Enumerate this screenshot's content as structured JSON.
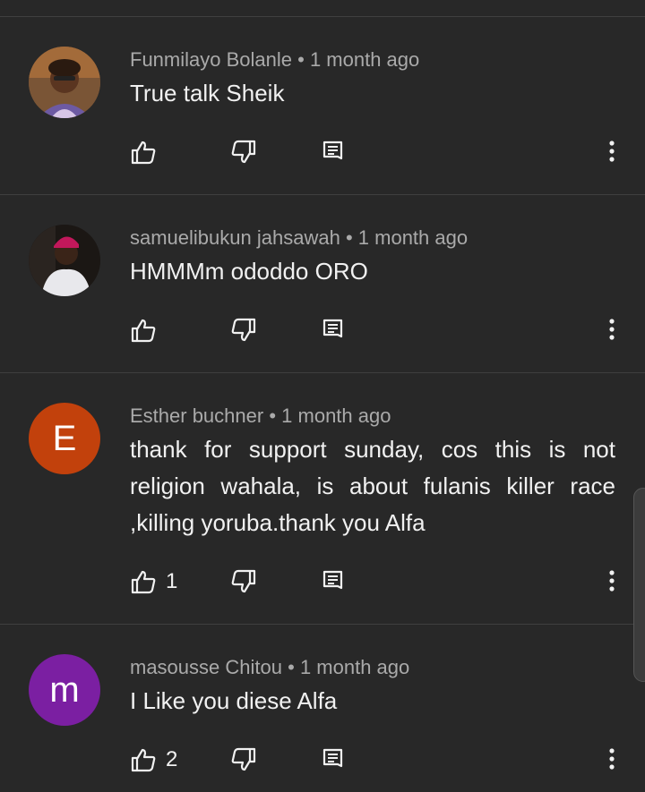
{
  "comments": [
    {
      "author": "Funmilayo Bolanle",
      "time": "1 month ago",
      "text": "True talk Sheik",
      "likes": "",
      "avatar": {
        "type": "photo",
        "bg": "#6b4a2a"
      }
    },
    {
      "author": "samuelibukun jahsawah",
      "time": "1 month ago",
      "text": "HMMMm ododdo ORO",
      "likes": "",
      "avatar": {
        "type": "photo",
        "bg": "#1e1a17"
      }
    },
    {
      "author": "Esther buchner",
      "time": "1 month ago",
      "text": "thank for support sunday, cos this is not religion wahala, is about fulanis killer race ,killing yoruba.thank you Alfa",
      "likes": "1",
      "avatar": {
        "type": "letter",
        "letter": "E",
        "bg": "#c2410c"
      }
    },
    {
      "author": "masousse Chitou",
      "time": "1 month ago",
      "text": "I Like you diese Alfa",
      "likes": "2",
      "avatar": {
        "type": "letter",
        "letter": "m",
        "bg": "#7b1fa2"
      }
    }
  ],
  "icons": {
    "like": "thumbs-up-icon",
    "dislike": "thumbs-down-icon",
    "reply": "reply-icon",
    "more": "more-vertical-icon"
  }
}
